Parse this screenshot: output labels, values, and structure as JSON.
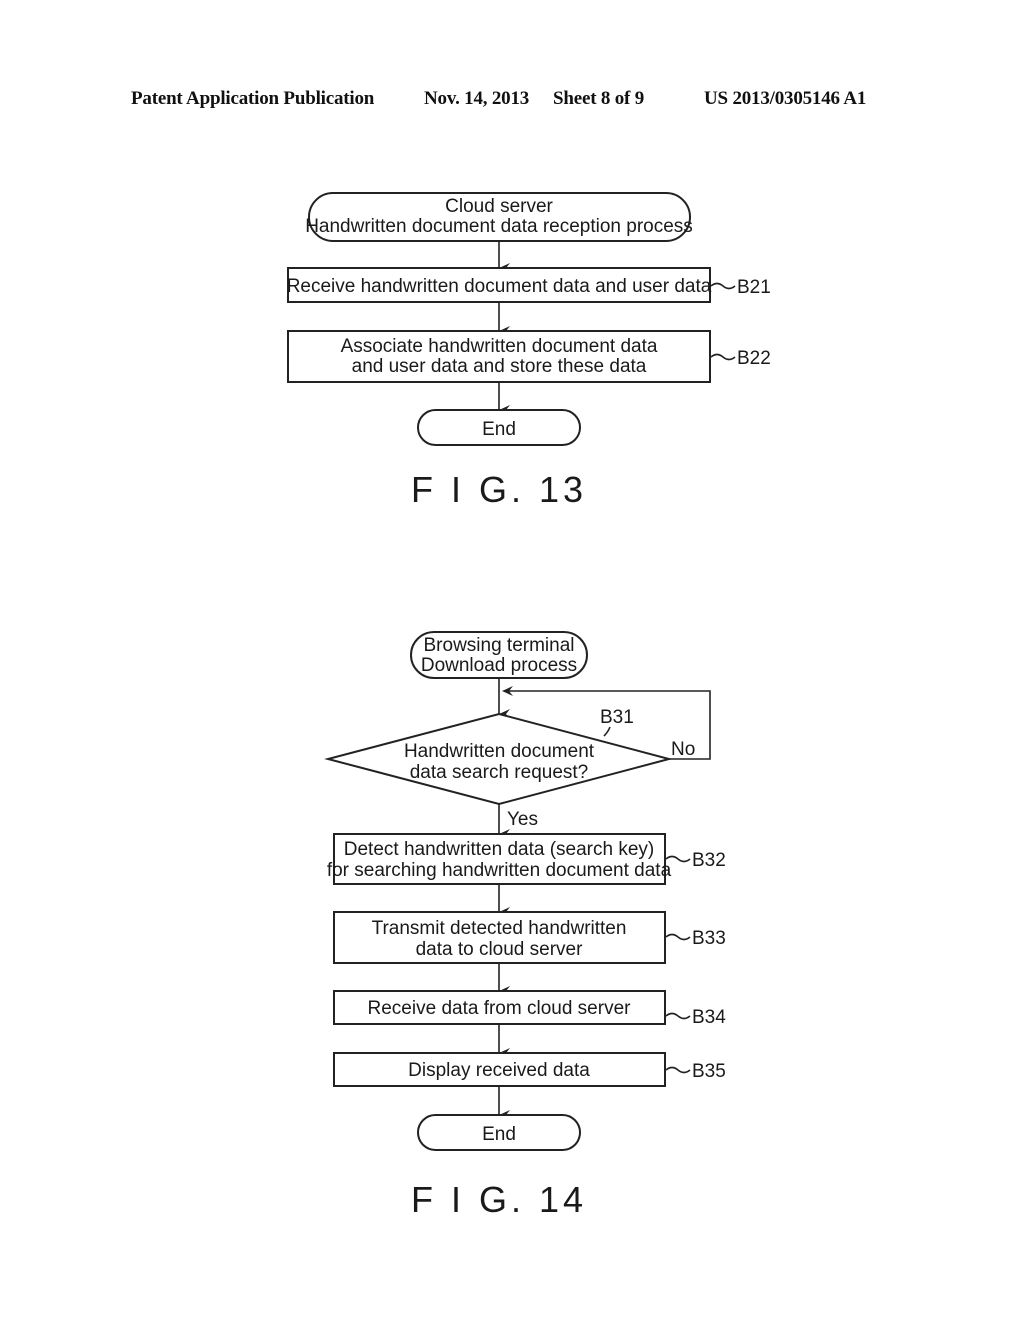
{
  "header": {
    "left": "Patent Application Publication",
    "date": "Nov. 14, 2013",
    "sheet": "Sheet 8 of 9",
    "number": "US 2013/0305146 A1"
  },
  "fig13": {
    "caption": "F I G. 13",
    "start": {
      "line1": "Cloud server",
      "line2": "Handwritten document data reception process"
    },
    "steps": [
      {
        "id": "B21",
        "lines": [
          "Receive handwritten document data and user data"
        ]
      },
      {
        "id": "B22",
        "lines": [
          "Associate handwritten document data",
          "and user data and store these data"
        ]
      }
    ],
    "end": "End"
  },
  "fig14": {
    "caption": "F I G. 14",
    "start": {
      "line1": "Browsing terminal",
      "line2": "Download process"
    },
    "decision": {
      "id": "B31",
      "line1": "Handwritten document",
      "line2": "data search request?",
      "yes": "Yes",
      "no": "No"
    },
    "steps": [
      {
        "id": "B32",
        "lines": [
          "Detect handwritten data (search key)",
          "for searching handwritten document data"
        ]
      },
      {
        "id": "B33",
        "lines": [
          "Transmit detected handwritten",
          "data to cloud server"
        ]
      },
      {
        "id": "B34",
        "lines": [
          "Receive data from cloud server"
        ]
      },
      {
        "id": "B35",
        "lines": [
          "Display received data"
        ]
      }
    ],
    "end": "End"
  }
}
